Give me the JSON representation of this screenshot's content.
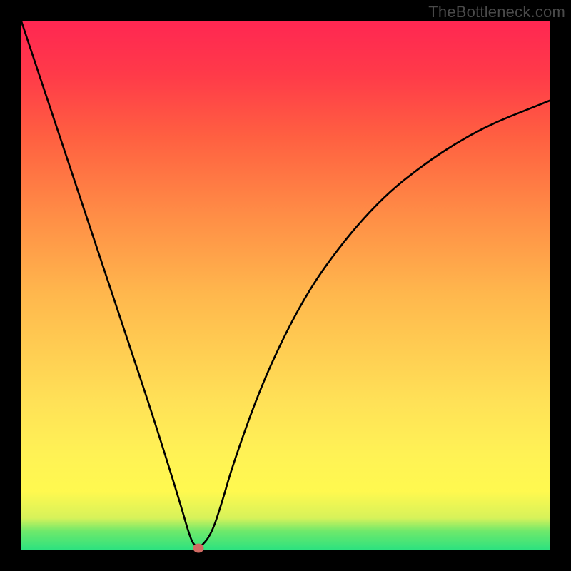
{
  "watermark": "TheBottleneck.com",
  "chart_data": {
    "type": "line",
    "title": "",
    "xlabel": "",
    "ylabel": "",
    "xlim": [
      0,
      100
    ],
    "ylim": [
      0,
      100
    ],
    "grid": false,
    "series": [
      {
        "name": "curve",
        "x": [
          0,
          5,
          10,
          15,
          20,
          25,
          30,
          32,
          33,
          34,
          36,
          38,
          40,
          45,
          50,
          55,
          60,
          65,
          70,
          75,
          80,
          85,
          90,
          95,
          100
        ],
        "y": [
          100,
          85,
          70,
          55,
          40,
          25,
          9,
          2,
          0.5,
          0.5,
          3,
          9,
          16,
          30,
          41,
          50,
          57,
          63,
          68,
          72,
          75.5,
          78.5,
          81,
          83,
          85
        ]
      }
    ],
    "marker": {
      "x": 33.5,
      "y": 0.3,
      "color": "#d26a63"
    },
    "gradient_stops": [
      {
        "pos": 0,
        "color": "#2de27f"
      },
      {
        "pos": 3.5,
        "color": "#6fe96b"
      },
      {
        "pos": 6,
        "color": "#d7f25a"
      },
      {
        "pos": 11,
        "color": "#fff94f"
      },
      {
        "pos": 18,
        "color": "#fff255"
      },
      {
        "pos": 28,
        "color": "#ffe157"
      },
      {
        "pos": 48,
        "color": "#ffb84d"
      },
      {
        "pos": 63,
        "color": "#ff8e46"
      },
      {
        "pos": 78,
        "color": "#ff6041"
      },
      {
        "pos": 90,
        "color": "#ff3a49"
      },
      {
        "pos": 100,
        "color": "#ff2752"
      }
    ]
  }
}
